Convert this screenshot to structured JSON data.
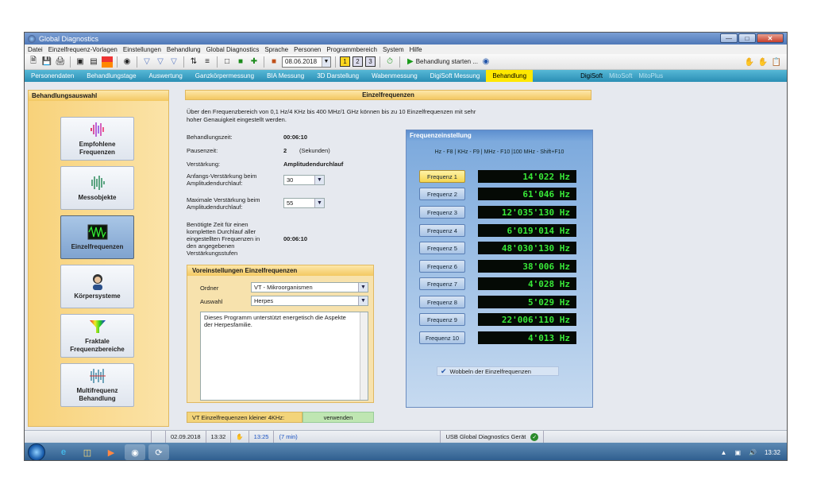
{
  "window": {
    "title": "Global Diagnostics"
  },
  "menu": [
    "Datei",
    "Einzelfrequenz-Vorlagen",
    "Einstellungen",
    "Behandlung",
    "Global Diagnostics",
    "Sprache",
    "Personen",
    "Programmbereich",
    "System",
    "Hilfe"
  ],
  "toolbar": {
    "date": "08.06.2018",
    "pages": [
      "1",
      "2",
      "3"
    ],
    "start_label": "Behandlung starten ..."
  },
  "tabs": {
    "items": [
      "Personendaten",
      "Behandlungstage",
      "Auswertung",
      "Ganzkörpermessung",
      "BIA Messung",
      "3D Darstellung",
      "Wabenmessung",
      "DigiSoft Messung",
      "Behandlung"
    ],
    "active_index": 8,
    "right": [
      "DigiSoft",
      "MitoSoft",
      "MitoPlus"
    ]
  },
  "sidebar": {
    "title": "Behandlungsauswahl",
    "items": [
      {
        "label": "Empfohlene Frequenzen",
        "icon": "frequency-wave-icon"
      },
      {
        "label": "Messobjekte",
        "icon": "measure-objects-icon"
      },
      {
        "label": "Einzelfrequenzen",
        "icon": "oscilloscope-icon"
      },
      {
        "label": "Körpersysteme",
        "icon": "person-head-icon"
      },
      {
        "label": "Fraktale Frequenzbereiche",
        "icon": "prism-funnel-icon"
      },
      {
        "label": "Multifrequenz Behandlung",
        "icon": "multi-frequency-icon"
      }
    ],
    "active_index": 2
  },
  "main": {
    "header": "Einzelfrequenzen",
    "intro_1": "Über den Frequenzbereich von 0,1 Hz/4 KHz bis 400 MHz/1 GHz können bis zu 10 Einzelfrequenzen mit sehr",
    "intro_2": "hoher Genauigkeit eingestellt werden.",
    "behandlungszeit_label": "Behandlungszeit:",
    "behandlungszeit_value": "00:06:10",
    "pausenzeit_label": "Pausenzeit:",
    "pausenzeit_value": "2",
    "pausenzeit_unit": "(Sekunden)",
    "verstaerkung_label": "Verstärkung:",
    "verstaerkung_value": "Amplitudendurchlauf",
    "anfang_label_1": "Anfangs-Verstärkung beim",
    "anfang_label_2": "Amplitudendurchlauf:",
    "anfang_value": "30",
    "max_label_1": "Maximale Verstärkung beim",
    "max_label_2": "Amplitudendurchlauf:",
    "max_value": "55",
    "zeit_label_1": "Benötigte Zeit für einen",
    "zeit_label_2": "kompletten Durchlauf aller",
    "zeit_label_3": "eingestellten Frequenzen in",
    "zeit_label_4": "den angegebenen",
    "zeit_label_5": "Verstärkungsstufen",
    "zeit_value": "00:06:10"
  },
  "voreinstellungen": {
    "title": "Voreinstellungen Einzelfrequenzen",
    "ordner_label": "Ordner",
    "ordner_value": "VT - Mikroorganismen",
    "auswahl_label": "Auswahl",
    "auswahl_value": "Herpes",
    "description": "Dieses Programm unterstützt energetisch die Aspekte der Herpesfamilie."
  },
  "vt_bar": {
    "label": "VT Einzelfrequenzen kleiner 4KHz:",
    "button": "verwenden"
  },
  "frequency_panel": {
    "title": "Frequenzeinstellung",
    "hint": "Hz - F8 | KHz - F9 | MHz - F10 |100 MHz - Shift+F10",
    "items": [
      {
        "label": "Frequenz 1",
        "value": "14'022  Hz"
      },
      {
        "label": "Frequenz 2",
        "value": "61'046  Hz"
      },
      {
        "label": "Frequenz 3",
        "value": "12'035'130  Hz"
      },
      {
        "label": "Frequenz 4",
        "value": "6'019'014  Hz"
      },
      {
        "label": "Frequenz 5",
        "value": "48'030'130  Hz"
      },
      {
        "label": "Frequenz 6",
        "value": "38'006  Hz"
      },
      {
        "label": "Frequenz 7",
        "value": "4'028  Hz"
      },
      {
        "label": "Frequenz 8",
        "value": "5'029  Hz"
      },
      {
        "label": "Frequenz 9",
        "value": "22'006'110  Hz"
      },
      {
        "label": "Frequenz 10",
        "value": "4'013  Hz"
      }
    ],
    "active_index": 0,
    "wobbel_label": "Wobbeln der Einzelfrequenzen",
    "wobbel_checked": true
  },
  "status": {
    "date": "02.09.2018",
    "time": "13:32",
    "time2": "13:25",
    "duration": "(7 min)",
    "device": "USB Global Diagnostics Gerät"
  },
  "taskbar": {
    "clock": "13:32"
  }
}
